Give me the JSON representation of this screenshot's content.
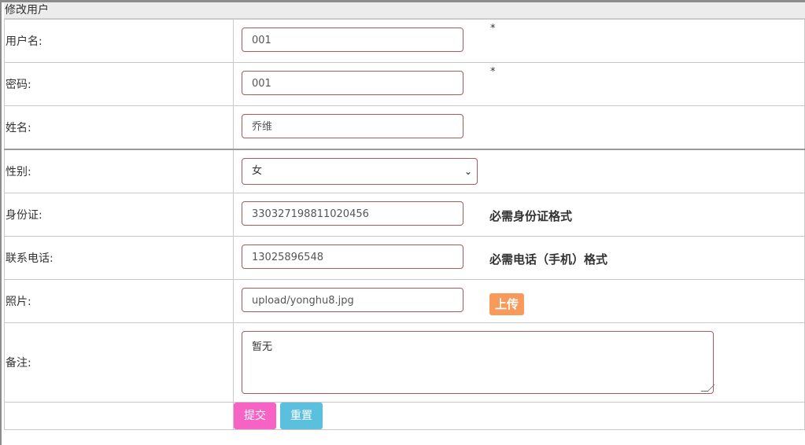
{
  "panel": {
    "title": "修改用户"
  },
  "fields": {
    "username": {
      "label": "用户名:",
      "value": "001",
      "required_mark": "*"
    },
    "password": {
      "label": "密码:",
      "value": "001",
      "required_mark": "*"
    },
    "name": {
      "label": "姓名:",
      "value": "乔维"
    },
    "gender": {
      "label": "性别:",
      "selected": "女",
      "chevron": "chevron-down-icon"
    },
    "id_card": {
      "label": "身份证:",
      "value": "330327198811020456",
      "hint": "必需身份证格式"
    },
    "phone": {
      "label": "联系电话:",
      "value": "13025896548",
      "hint": "必需电话（手机）格式"
    },
    "photo": {
      "label": "照片:",
      "value": "upload/yonghu8.jpg",
      "upload_label": "上传"
    },
    "remark": {
      "label": "备注:",
      "value": "暂无"
    }
  },
  "actions": {
    "submit_label": "提交",
    "reset_label": "重置"
  },
  "colors": {
    "input_border": "#a85959",
    "upload_button": "#f79a5c",
    "submit_button": "#f763c5",
    "reset_button": "#5bc0de"
  }
}
